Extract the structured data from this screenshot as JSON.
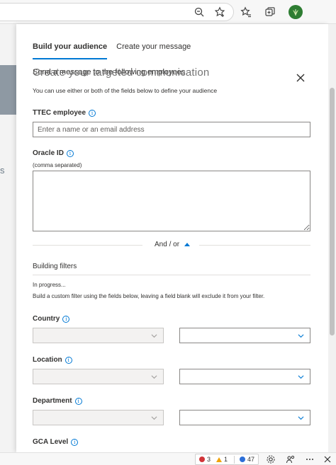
{
  "browser": {
    "icons": [
      "zoom-out-icon",
      "add-favorite-icon",
      "favorites-icon",
      "collections-icon",
      "profile-avatar"
    ]
  },
  "tabs": [
    {
      "label": "Build your audience",
      "active": true
    },
    {
      "label": "Create your message",
      "active": false
    }
  ],
  "header": {
    "overlap_text": "Send a message to the following employees",
    "title": "Create your targeted communication",
    "description": "You can use either or both of the fields below to define your audience"
  },
  "fields": {
    "employee_label": "TTEC employee",
    "employee_placeholder": "Enter a name or an email address",
    "oracle_label": "Oracle ID",
    "oracle_sublabel": "(comma separated)",
    "andor": "And / or"
  },
  "filters": {
    "title": "Building filters",
    "progress": "In progress...",
    "help": "Build a custom filter using the fields below, leaving a field blank will exclude it from your filter.",
    "country_label": "Country",
    "location_label": "Location",
    "department_label": "Department",
    "gca_label": "GCA Level"
  },
  "statusbar": {
    "errors": "3",
    "warnings": "1",
    "info": "47"
  },
  "colors": {
    "accent": "#0078d4",
    "error": "#d13438",
    "warning": "#f0a30a",
    "info": "#2d6fd8"
  }
}
